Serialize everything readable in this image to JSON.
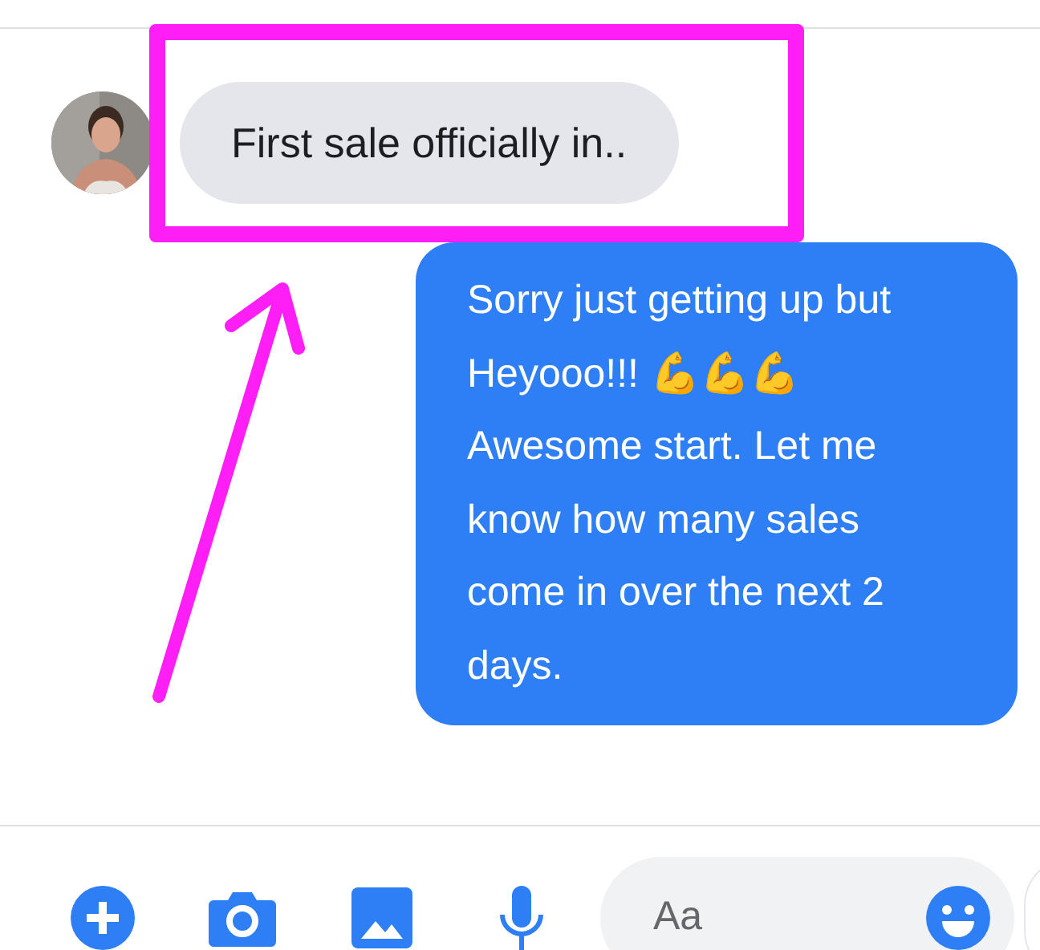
{
  "messages": [
    {
      "kind": "incoming",
      "text": "First sale officially in.."
    },
    {
      "kind": "outgoing",
      "text": "Sorry just getting up but Heyooo!!! 💪💪💪 Awesome start. Let me know how many sales come in over the next 2 days."
    }
  ],
  "composer": {
    "placeholder": "Aa"
  }
}
